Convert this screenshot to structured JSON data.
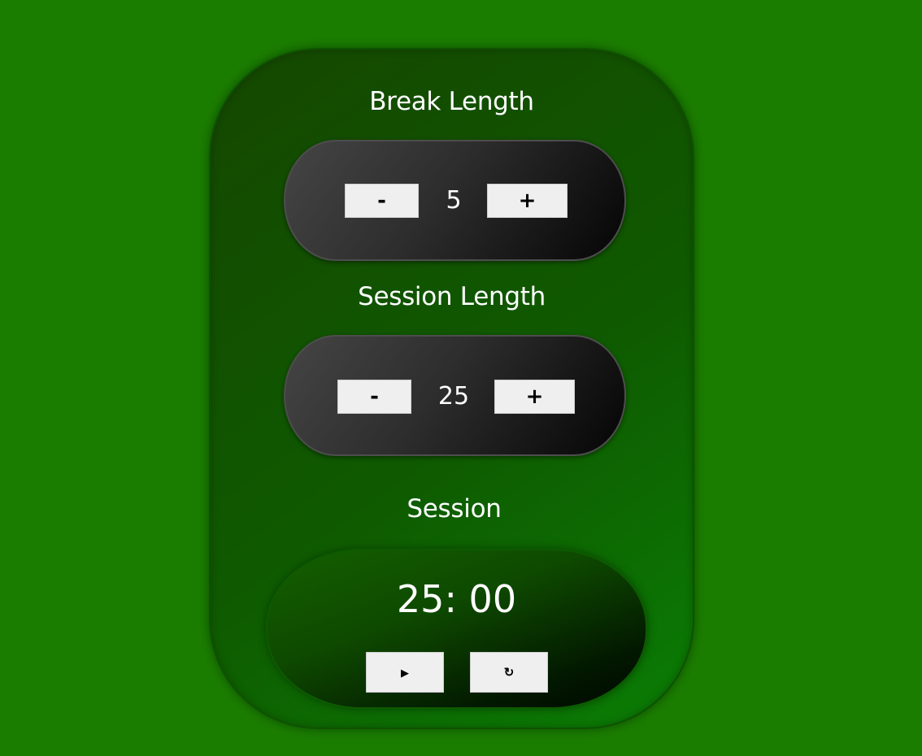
{
  "break": {
    "title": "Break Length",
    "decrement_label": "-",
    "value": "5",
    "increment_label": "+"
  },
  "session": {
    "title": "Session Length",
    "decrement_label": "-",
    "value": "25",
    "increment_label": "+"
  },
  "timer": {
    "label": "Session",
    "time": "25: 00",
    "play_icon": "▶",
    "reset_icon": "↻"
  },
  "colors": {
    "background": "#1b7d00",
    "card": "#154700",
    "pill": "#2d2d2d",
    "button": "#efefef",
    "text": "#ffffff"
  },
  "icons": {
    "play": "play-icon",
    "reset": "refresh-icon"
  }
}
